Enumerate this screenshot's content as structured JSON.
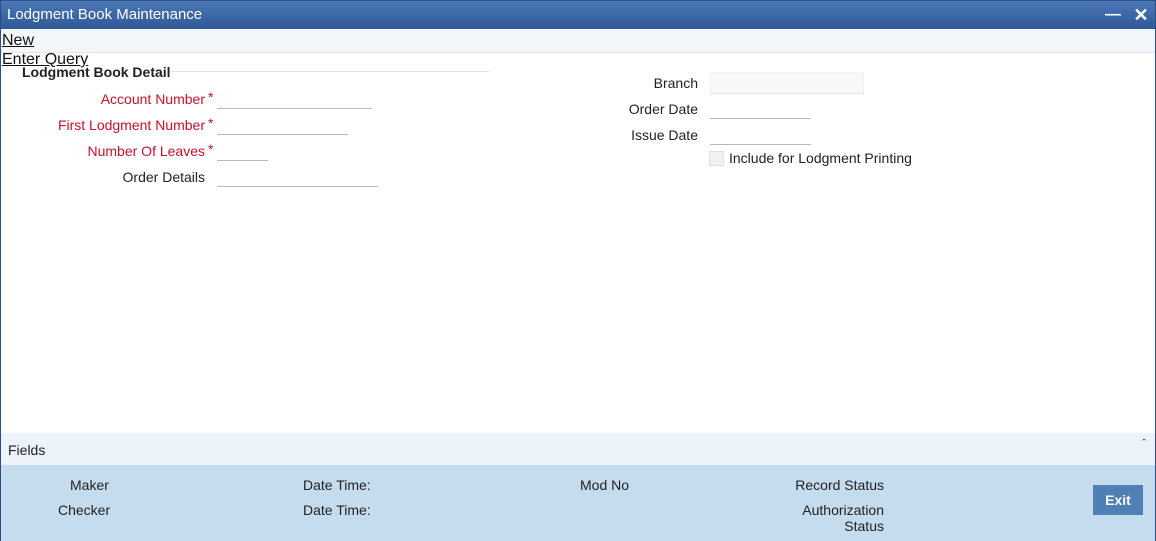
{
  "window": {
    "title": "Lodgment Book Maintenance"
  },
  "menu": {
    "new": "New",
    "enter_query": "Enter Query"
  },
  "section": {
    "title": "Lodgment Book Detail"
  },
  "form": {
    "account_number": {
      "label": "Account Number",
      "required_mark": "*",
      "value": ""
    },
    "first_lodgment_number": {
      "label": "First Lodgment Number",
      "required_mark": "*",
      "value": ""
    },
    "number_of_leaves": {
      "label": "Number Of Leaves",
      "required_mark": "*",
      "value": ""
    },
    "order_details": {
      "label": "Order Details",
      "value": ""
    },
    "branch": {
      "label": "Branch",
      "value": ""
    },
    "order_date": {
      "label": "Order Date",
      "value": ""
    },
    "issue_date": {
      "label": "Issue Date",
      "value": ""
    },
    "include_printing": {
      "label": "Include for Lodgment Printing",
      "checked": false
    }
  },
  "fields_bar": {
    "label": "Fields"
  },
  "audit": {
    "maker": "Maker",
    "date_time_1": "Date Time:",
    "mod_no": "Mod No",
    "record_status": "Record Status",
    "checker": "Checker",
    "date_time_2": "Date Time:",
    "authorization_line1": "Authorization",
    "authorization_line2": "Status"
  },
  "buttons": {
    "exit": "Exit"
  },
  "colors": {
    "titlebar": "#3a66a6",
    "required": "#c8102e",
    "audit_bg": "#c5dcee",
    "exit_btn": "#4f7fb5"
  }
}
